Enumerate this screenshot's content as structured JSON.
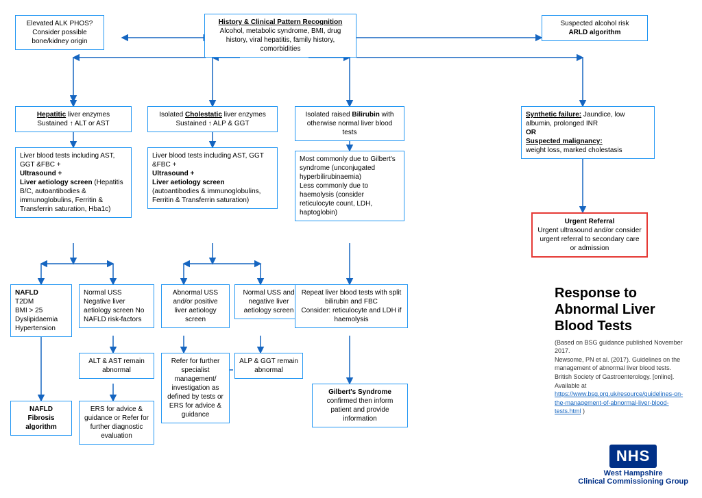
{
  "title": "Response to Abnormal Liver Blood Tests",
  "subtitle_based": "(Based on BSG guidance published November 2017.",
  "subtitle_ref": "Newsome, PN et al. (2017). Guidelines on the management of abnormal liver blood tests. British Society of Gastroenterology. [online]. Available at",
  "subtitle_url": "https://www.bsg.org.uk/resource/guidelines-on-the-management-of-abnormal-liver-blood-tests.html",
  "subtitle_end": " )",
  "nhs": "NHS",
  "org_name": "West Hampshire",
  "org_sub": "Clinical Commissioning Group",
  "box_top_center": "History & Clinical Pattern Recognition\nAlcohol, metabolic syndrome, BMI, drug history, viral hepatitis, family history, comorbidities",
  "box_top_left": "Elevated ALK PHOS?\nConsider possible bone/kidney origin",
  "box_top_right": "Suspected alcohol risk\nARLD algorithm",
  "box_hepatitic": "Hepatitic liver enzymes\nSustained ↑ ALT or AST",
  "box_cholestatic": "Isolated Cholestatic liver enzymes\nSustained ↑ ALP & GGT",
  "box_bilirubin": "Isolated raised Bilirubin with otherwise normal liver blood tests",
  "box_synthetic": "Synthetic failure: Jaundice, low albumin, prolonged INR\nOR\nSuspected malignancy:\nweight loss, marked cholestasis",
  "box_lbt1": "Liver blood tests including AST, GGT &FBC +\nUltrasound +\nLiver aetiology screen (Hepatitis B/C, autoantibodies & immunoglobulins, Ferritin & Transferrin saturation, Hba1c)",
  "box_lbt2": "Liver blood tests including AST, GGT &FBC +\nUltrasound +\nLiver aetiology screen\n(autoantibodies & immunoglobulins, Ferritin & Transferrin saturation)",
  "box_gilberts_text": "Most commonly due to Gilbert's syndrome (unconjugated hyperbilirubinaemia)\nLess commonly due to haemolysis (consider reticulocyte count, LDH, haptoglobin)",
  "box_urgent": "Urgent Referral\nUrgent ultrasound and/or consider urgent referral to secondary care or admission",
  "box_nafld_risk": "NAFLD\nT2DM\nBMI > 25\nDyslipidaemia\nHypertension",
  "box_normal_uss": "Normal USS\nNegative liver aetiology screen No NAFLD risk-factors",
  "box_abnormal_uss": "Abnormal USS and/or positive liver aetiology screen",
  "box_normal_uss2": "Normal USS and negative liver aetiology screen",
  "box_repeat_lbt": "Repeat liver blood tests with split bilirubin and FBC\nConsider: reticulocyte and LDH if haemolysis",
  "box_alt_ast": "ALT & AST remain abnormal",
  "box_alp_ggt": "ALP & GGT remain abnormal",
  "box_gilberts_confirmed": "Gilbert's Syndrome\nconfirmed then inform patient and provide information",
  "box_nafld_fibrosis": "NAFLD\nFibrosis\nalgorithm",
  "box_ers_advice": "ERS for advice & guidance\nor\nRefer for further diagnostic evaluation",
  "box_refer_specialist": "Refer for further specialist management/ investigation as defined by tests\nor\nERS for advice & guidance"
}
